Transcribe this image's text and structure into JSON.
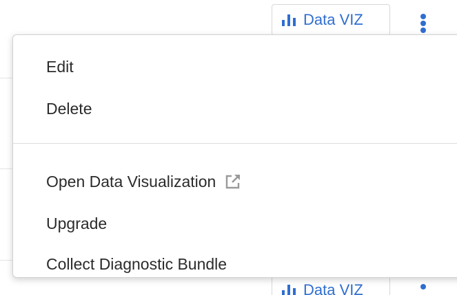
{
  "toolbar": {
    "viz_label": "Data VIZ",
    "viz_icon": "bar-chart-icon",
    "more_icon": "kebab-vertical-icon"
  },
  "menu": {
    "items": [
      {
        "label": "Edit"
      },
      {
        "label": "Delete"
      },
      {
        "label": "Open Data Visualization",
        "icon": "external-link-icon"
      },
      {
        "label": "Upgrade"
      },
      {
        "label": "Collect Diagnostic Bundle"
      }
    ]
  },
  "colors": {
    "accent": "#2f6ed0",
    "text": "#2b2b2b",
    "divider": "#dcdcdc",
    "icon_gray": "#9a9a9a"
  }
}
